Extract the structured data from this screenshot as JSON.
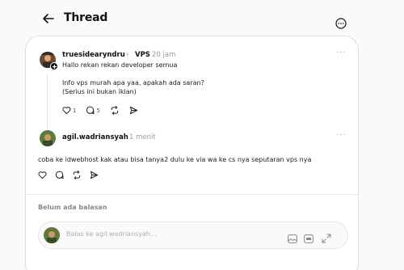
{
  "header": {
    "title": "Thread"
  },
  "post": {
    "username": "truesidearyndru",
    "separator": "›",
    "topic": "VPS",
    "time": "20 jam",
    "greeting": "Hallo rekan rekan developer semua",
    "body_line1": "Info vps murah apa yaa, apakah ada saran?",
    "body_line2": "(Serius ini bukan iklan)",
    "likes": "1",
    "replies": "5"
  },
  "comment": {
    "username": "agil.wadriansyah",
    "time": "1 menit",
    "body": "coba ke idwebhost kak atau bisa tanya2 dulu ke via wa ke cs nya seputaran vps nya"
  },
  "replies_section": {
    "label": "Belum ada balasan"
  },
  "reply": {
    "placeholder": "Balas ke agil.wadriansyah..."
  },
  "icons": {
    "back": "arrow-left-icon",
    "more": "ellipsis-circle-icon",
    "like": "heart-icon",
    "comment": "speech-bubble-icon",
    "repost": "repost-icon",
    "share": "send-icon",
    "image": "image-icon",
    "gif": "gif-icon",
    "expand": "expand-icon"
  },
  "colors": {
    "accent": "#111111",
    "muted": "#9a9a9a",
    "border": "#e0e0e0"
  }
}
